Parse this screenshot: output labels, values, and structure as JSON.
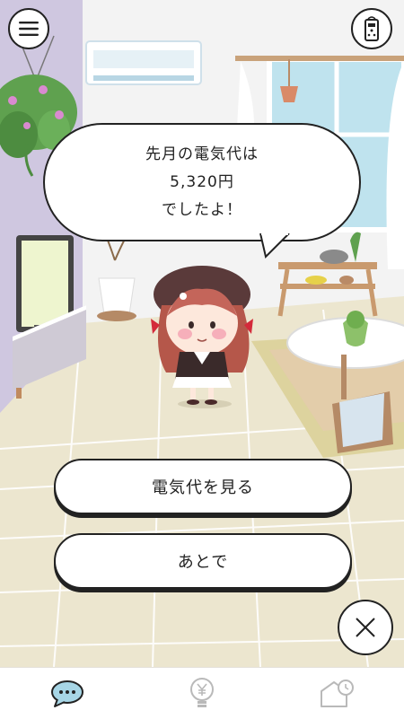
{
  "bubble": {
    "lines": [
      "先月の電気代は",
      "5,320円",
      "でしたよ！"
    ]
  },
  "actions": {
    "view_label": "電気代を見る",
    "later_label": "あとで"
  },
  "icons": {
    "menu": "hamburger-menu-icon",
    "remote": "remote-control-icon",
    "close": "close-icon",
    "tab_chat": "chat-bubble-icon",
    "tab_cost": "lightbulb-yen-icon",
    "tab_history": "house-clock-icon"
  },
  "colors": {
    "outline": "#222222",
    "chat_tab": "#a7d6e6",
    "inactive_tab": "#b9b9b9",
    "floor": "#ece6cf",
    "wall": "#f3f3f3",
    "accent_wall": "#cfc7e0"
  }
}
